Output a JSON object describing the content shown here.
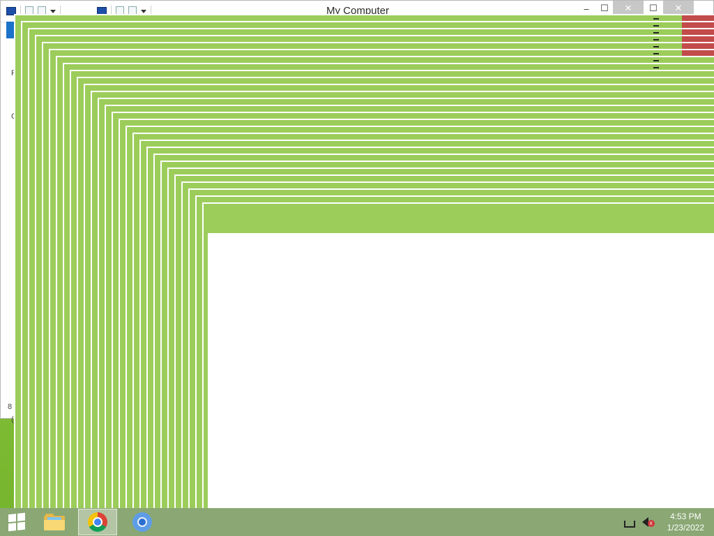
{
  "background_window": {
    "title": "My Computer",
    "minimize_glyph": "–",
    "maximize_glyph": "☐",
    "close_glyph": "✕",
    "side_letters": [
      "F",
      "C",
      "8",
      "("
    ]
  },
  "cascade": {
    "window_color": "#9ccd5b",
    "close_color": "#c24b4b"
  },
  "taskbar": {
    "items": [
      {
        "name": "file-explorer",
        "icon": "folder-icon"
      },
      {
        "name": "google-chrome",
        "icon": "chrome-icon",
        "active": true
      },
      {
        "name": "chromium",
        "icon": "chromium-icon"
      }
    ],
    "tray": {
      "network_icon": "network-icon",
      "volume_icon": "volume-muted-icon"
    },
    "clock": {
      "time": "4:53 PM",
      "date": "1/23/2022"
    }
  }
}
